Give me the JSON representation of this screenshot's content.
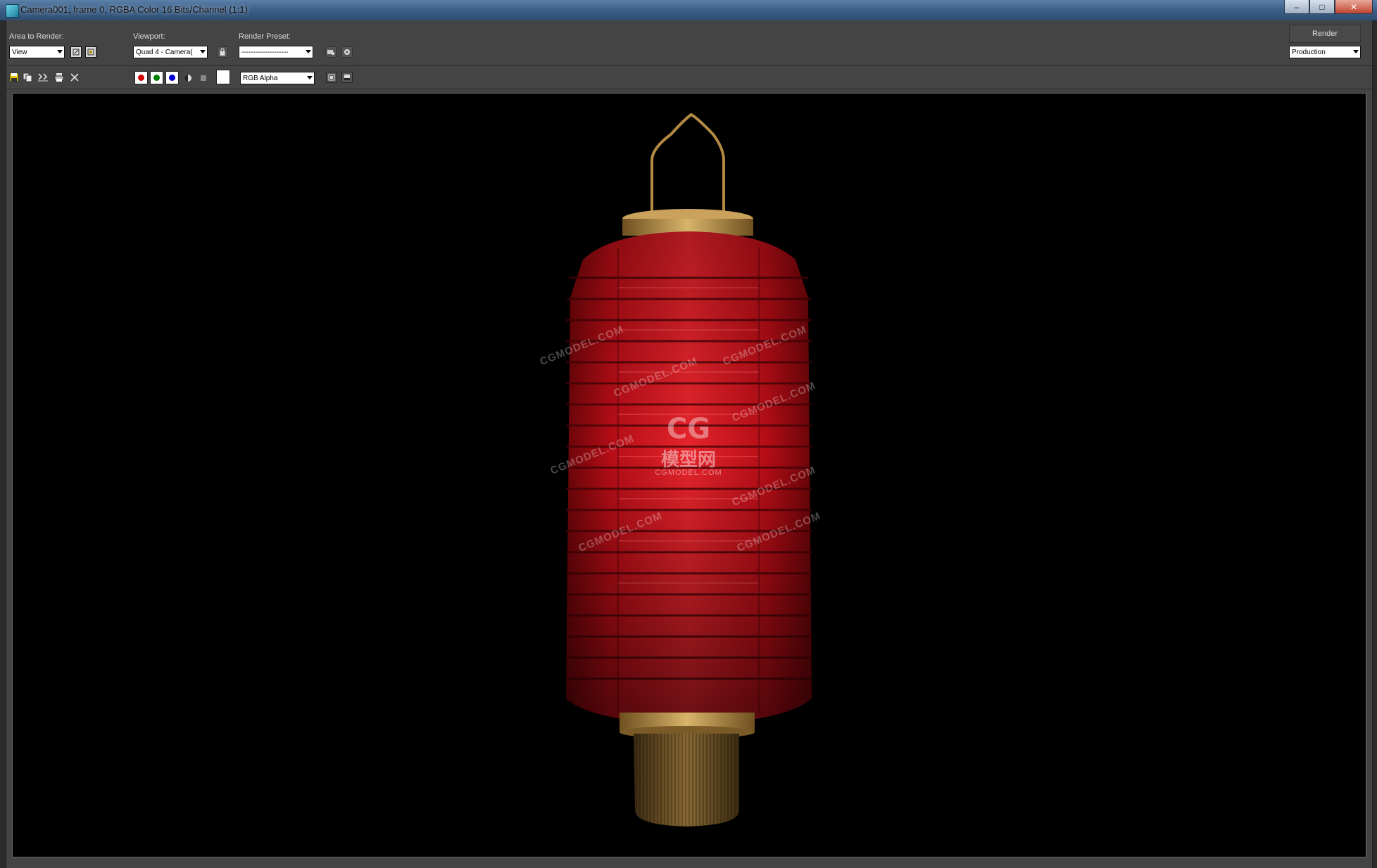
{
  "window": {
    "title": "Camera001, frame 0, RGBA Color 16 Bits/Channel (1:1)",
    "controls": [
      "–",
      "□",
      "✕"
    ]
  },
  "toolbar": {
    "area_to_render_label": "Area to Render:",
    "area_to_render_value": "View",
    "viewport_label": "Viewport:",
    "viewport_value": "Quad 4 - Camera(",
    "render_preset_label": "Render Preset:",
    "render_preset_value": "--------------------",
    "render_button": "Render",
    "render_mode_value": "Production"
  },
  "channel_toolbar": {
    "channel_display_value": "RGB Alpha",
    "channels": [
      {
        "name": "red",
        "color": "#d40000",
        "enabled": true
      },
      {
        "name": "green",
        "color": "#008000",
        "enabled": true
      },
      {
        "name": "blue",
        "color": "#0000d4",
        "enabled": true
      }
    ]
  },
  "render": {
    "background": "#000000",
    "watermarks": [
      "CGMODEL.COM",
      "CGMODEL.COM",
      "CGMODEL.COM",
      "CGMODEL.COM",
      "CGMODEL.COM",
      "CGMODEL.COM",
      "CGMODEL.COM",
      "CGMODEL.COM"
    ],
    "logo_text": "模型网",
    "logo_sub": "CGMODEL.COM",
    "colors": {
      "lantern_red": "#d8141c",
      "lantern_dark": "#5a0508",
      "gold": "#b8924a"
    }
  }
}
